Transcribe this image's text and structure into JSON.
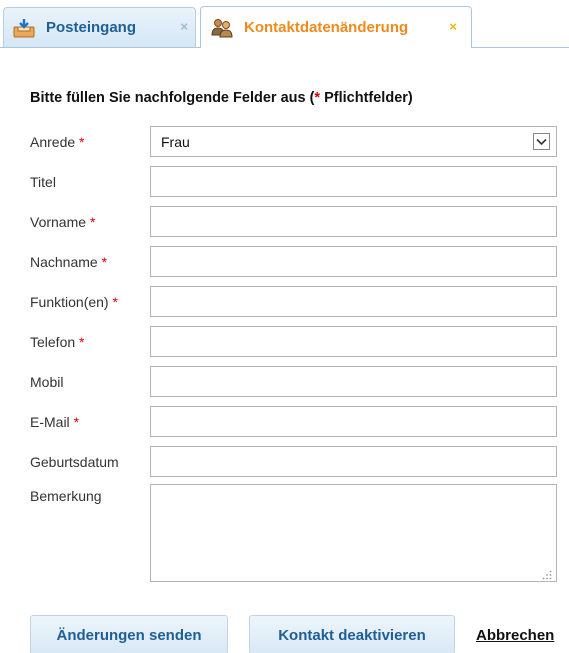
{
  "tabs": [
    {
      "label": "Posteingang",
      "icon": "inbox-tray-icon",
      "close": "×"
    },
    {
      "label": "Kontaktdatenänderung",
      "icon": "contacts-people-icon",
      "close": "×",
      "active": true
    }
  ],
  "form": {
    "heading_text": "Bitte füllen Sie nachfolgende Felder aus (",
    "heading_star": "*",
    "heading_rest": " Pflichtfelder)",
    "required_mark": "*",
    "fields": [
      {
        "label": "Anrede",
        "required": true,
        "type": "select",
        "value": "Frau"
      },
      {
        "label": "Titel",
        "required": false,
        "type": "text",
        "value": ""
      },
      {
        "label": "Vorname",
        "required": true,
        "type": "text",
        "value": ""
      },
      {
        "label": "Nachname",
        "required": true,
        "type": "text",
        "value": ""
      },
      {
        "label": "Funktion(en)",
        "required": true,
        "type": "text",
        "value": ""
      },
      {
        "label": "Telefon",
        "required": true,
        "type": "text",
        "value": ""
      },
      {
        "label": "Mobil",
        "required": false,
        "type": "text",
        "value": ""
      },
      {
        "label": "E-Mail",
        "required": true,
        "type": "text",
        "value": ""
      },
      {
        "label": "Geburtsdatum",
        "required": false,
        "type": "text",
        "value": ""
      },
      {
        "label": "Bemerkung",
        "required": false,
        "type": "textarea",
        "value": ""
      }
    ]
  },
  "actions": {
    "send_label": "Änderungen senden",
    "deactivate_label": "Kontakt deaktivieren",
    "cancel_label": "Abbrechen"
  },
  "colors": {
    "accent_blue": "#1e5f96",
    "accent_orange": "#f08a1c",
    "required_red": "#d80000"
  }
}
